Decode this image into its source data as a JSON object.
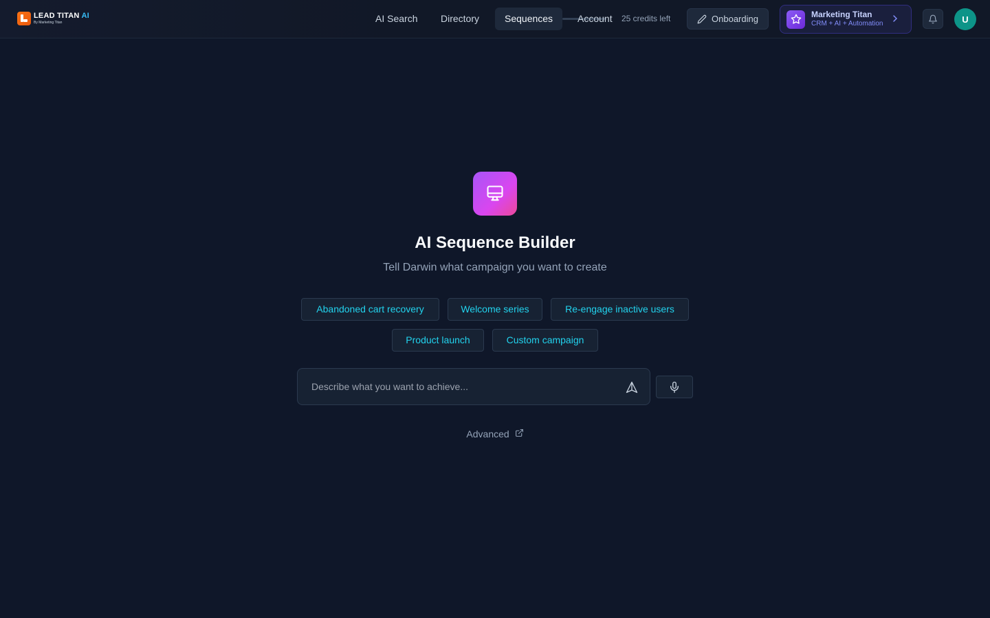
{
  "brand": {
    "name_main": "LEAD TITAN",
    "name_ai": "AI",
    "byline": "By Marketing Titan",
    "accent": "#38bdf8"
  },
  "nav": {
    "items": [
      {
        "label": "AI Search",
        "active": false
      },
      {
        "label": "Directory",
        "active": false
      },
      {
        "label": "Sequences",
        "active": true
      },
      {
        "label": "Account",
        "active": false
      }
    ],
    "credits": "25 credits left",
    "onboarding_label": "Onboarding",
    "promo": {
      "title": "Marketing Titan",
      "subtitle": "CRM + AI + Automation"
    },
    "avatar_initial": "U",
    "icons": {
      "onboarding": "pencil-icon",
      "promo": "star-icon",
      "promo_chevron": "chevron-right-icon",
      "notifications": "bell-icon"
    }
  },
  "hero": {
    "icon": "monitor-icon",
    "title": "AI Sequence Builder",
    "subtitle": "Tell Darwin what campaign you want to create"
  },
  "suggestions": [
    "Abandoned cart recovery",
    "Welcome series",
    "Re-engage inactive users",
    "Product launch",
    "Custom campaign"
  ],
  "prompt": {
    "placeholder": "Describe what you want to achieve...",
    "value": "",
    "send_icon": "send-icon",
    "mic_icon": "microphone-icon"
  },
  "advanced_link": {
    "label": "Advanced",
    "icon": "external-link-icon"
  },
  "colors": {
    "background": "#0f1729",
    "chip_text": "#22d3ee",
    "hero_gradient_start": "#a855f7",
    "hero_gradient_end": "#ec4899",
    "avatar": "#0d9488"
  }
}
